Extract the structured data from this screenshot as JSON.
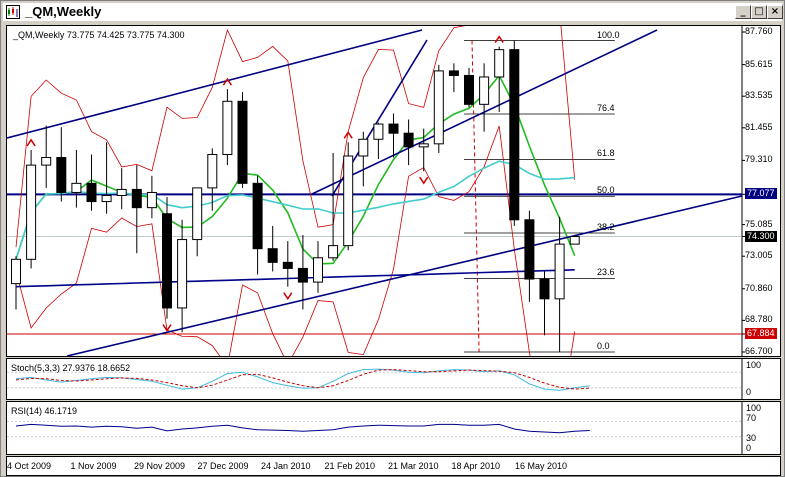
{
  "window": {
    "title": "_QM,Weekly",
    "buttons": {
      "minimize": "_",
      "maximize": "□",
      "close": "×"
    }
  },
  "main_chart": {
    "header": "_QM,Weekly  73.775 74.425 73.775 74.300",
    "price_axis": [
      "87.760",
      "85.615",
      "83.535",
      "81.455",
      "79.310",
      "77.077",
      "75.085",
      "74.300",
      "73.005",
      "70.860",
      "68.780",
      "67.884",
      "66.700"
    ],
    "fib_levels": [
      "100.0",
      "76.4",
      "61.8",
      "50.0",
      "38.2",
      "23.6",
      "0.0"
    ],
    "current_price_tag": "74.300",
    "h_line_tag": "77.077",
    "red_line_tag": "67.884",
    "colors": {
      "up_candle": "#ffffff",
      "down_candle": "#000000",
      "ma_green": "#22bb22",
      "ma_cyan": "#44cccc",
      "ma_blue": "#00008b",
      "bollinger": "#cc0000",
      "trendline": "#000080",
      "fractal": "#cc0000"
    }
  },
  "stoch_panel": {
    "header": "Stoch(5,3,3) 27.9376 18.6652",
    "axis": [
      "100",
      "0"
    ],
    "colors": {
      "main": "#44bbdd",
      "signal": "#cc0000"
    }
  },
  "rsi_panel": {
    "header": "RSI(14) 46.1719",
    "axis": [
      "100",
      "70",
      "30",
      "0"
    ],
    "colors": {
      "line": "#00008b"
    }
  },
  "time_axis": [
    "4 Oct 2009",
    "1 Nov 2009",
    "29 Nov 2009",
    "27 Dec 2009",
    "24 Jan 2010",
    "21 Feb 2010",
    "21 Mar 2010",
    "18 Apr 2010",
    "16 May 2010"
  ],
  "chart_data": [
    {
      "type": "candlestick",
      "title": "_QM,Weekly",
      "ylim": [
        66.7,
        87.76
      ],
      "candles": [
        {
          "o": 71.2,
          "h": 73.0,
          "l": 69.5,
          "c": 72.8
        },
        {
          "o": 72.8,
          "h": 80.0,
          "l": 72.2,
          "c": 79.0
        },
        {
          "o": 79.0,
          "h": 81.6,
          "l": 77.5,
          "c": 79.5
        },
        {
          "o": 79.5,
          "h": 81.5,
          "l": 76.6,
          "c": 77.2
        },
        {
          "o": 77.2,
          "h": 80.0,
          "l": 76.2,
          "c": 77.8
        },
        {
          "o": 77.8,
          "h": 79.7,
          "l": 76.0,
          "c": 76.6
        },
        {
          "o": 76.6,
          "h": 80.5,
          "l": 75.8,
          "c": 77.0
        },
        {
          "o": 77.0,
          "h": 78.8,
          "l": 76.1,
          "c": 77.4
        },
        {
          "o": 77.4,
          "h": 79.0,
          "l": 73.2,
          "c": 76.2
        },
        {
          "o": 76.2,
          "h": 78.3,
          "l": 75.5,
          "c": 77.2
        },
        {
          "o": 75.8,
          "h": 76.9,
          "l": 68.9,
          "c": 69.6
        },
        {
          "o": 69.6,
          "h": 75.4,
          "l": 68.0,
          "c": 74.1
        },
        {
          "o": 74.1,
          "h": 77.0,
          "l": 73.0,
          "c": 77.5
        },
        {
          "o": 77.5,
          "h": 80.1,
          "l": 76.0,
          "c": 79.7
        },
        {
          "o": 79.7,
          "h": 84.0,
          "l": 79.0,
          "c": 83.2
        },
        {
          "o": 83.2,
          "h": 83.8,
          "l": 77.5,
          "c": 77.8
        },
        {
          "o": 77.8,
          "h": 78.3,
          "l": 71.8,
          "c": 73.5
        },
        {
          "o": 73.5,
          "h": 75.0,
          "l": 72.0,
          "c": 72.6
        },
        {
          "o": 72.6,
          "h": 74.0,
          "l": 71.0,
          "c": 72.2
        },
        {
          "o": 72.2,
          "h": 74.4,
          "l": 69.5,
          "c": 71.3
        },
        {
          "o": 71.3,
          "h": 74.0,
          "l": 70.6,
          "c": 72.9
        },
        {
          "o": 72.9,
          "h": 79.8,
          "l": 72.7,
          "c": 73.7
        },
        {
          "o": 73.7,
          "h": 80.5,
          "l": 73.4,
          "c": 79.6
        },
        {
          "o": 79.6,
          "h": 81.2,
          "l": 77.6,
          "c": 80.7
        },
        {
          "o": 80.7,
          "h": 81.8,
          "l": 79.4,
          "c": 81.7
        },
        {
          "o": 81.7,
          "h": 82.4,
          "l": 79.5,
          "c": 81.1
        },
        {
          "o": 81.1,
          "h": 82.0,
          "l": 79.0,
          "c": 80.2
        },
        {
          "o": 80.2,
          "h": 81.4,
          "l": 78.6,
          "c": 80.4
        },
        {
          "o": 80.4,
          "h": 85.6,
          "l": 79.8,
          "c": 85.2
        },
        {
          "o": 85.2,
          "h": 85.7,
          "l": 83.8,
          "c": 84.9
        },
        {
          "o": 84.9,
          "h": 85.4,
          "l": 82.8,
          "c": 83.0
        },
        {
          "o": 83.0,
          "h": 85.7,
          "l": 81.2,
          "c": 84.8
        },
        {
          "o": 84.8,
          "h": 86.8,
          "l": 82.5,
          "c": 86.6
        },
        {
          "o": 86.6,
          "h": 87.2,
          "l": 75.0,
          "c": 75.4
        },
        {
          "o": 75.4,
          "h": 76.0,
          "l": 70.0,
          "c": 71.5
        },
        {
          "o": 71.5,
          "h": 72.0,
          "l": 67.8,
          "c": 70.2
        },
        {
          "o": 70.2,
          "h": 75.6,
          "l": 66.7,
          "c": 73.8
        },
        {
          "o": 73.8,
          "h": 74.4,
          "l": 73.8,
          "c": 74.3
        }
      ],
      "horizontal_lines": [
        77.077,
        67.884
      ],
      "fibonacci": {
        "high": 87.2,
        "low": 66.7,
        "levels": [
          0.0,
          23.6,
          38.2,
          50.0,
          61.8,
          76.4,
          100.0
        ]
      }
    },
    {
      "type": "line",
      "title": "Stoch(5,3,3) 27.9376 18.6652",
      "ylim": [
        0,
        100
      ],
      "series": [
        {
          "name": "Stoch(5,3,3)",
          "values": [
            55,
            60,
            50,
            42,
            48,
            55,
            60,
            58,
            52,
            45,
            30,
            15,
            20,
            45,
            75,
            80,
            62,
            40,
            28,
            18,
            20,
            45,
            75,
            90,
            92,
            88,
            80,
            78,
            85,
            90,
            88,
            82,
            85,
            70,
            35,
            15,
            10,
            20,
            27.9376
          ]
        },
        {
          "name": "Signal",
          "values": [
            50,
            56,
            55,
            48,
            46,
            50,
            55,
            58,
            56,
            50,
            40,
            28,
            20,
            30,
            50,
            70,
            72,
            58,
            42,
            28,
            20,
            28,
            48,
            72,
            88,
            90,
            86,
            82,
            82,
            85,
            88,
            86,
            84,
            78,
            60,
            38,
            22,
            15,
            18.6652
          ]
        }
      ]
    },
    {
      "type": "line",
      "title": "RSI(14) 46.1719",
      "ylim": [
        0,
        100
      ],
      "series": [
        {
          "name": "RSI(14)",
          "values": [
            58,
            62,
            60,
            57,
            58,
            55,
            57,
            56,
            52,
            55,
            45,
            50,
            53,
            57,
            60,
            53,
            48,
            47,
            46,
            44,
            46,
            48,
            55,
            58,
            60,
            59,
            58,
            58,
            62,
            62,
            60,
            60,
            62,
            50,
            44,
            42,
            40,
            44,
            46.1719
          ]
        }
      ]
    }
  ]
}
